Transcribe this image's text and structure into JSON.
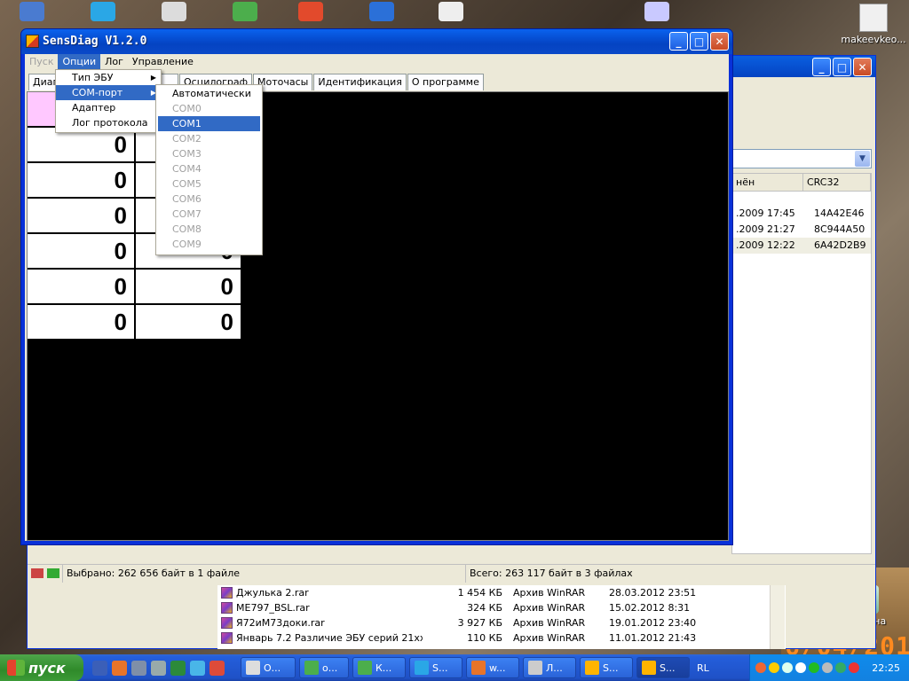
{
  "desktop": {
    "icon_user": "makeevkeo...",
    "icon_recycle": "Корзина",
    "date_stamp": "6/04/201"
  },
  "explorer": {
    "list_headers": [
      "нён",
      "CRC32"
    ],
    "list_rows": [
      {
        "date": ".2009 17:45",
        "crc": "14A42E46"
      },
      {
        "date": ".2009 21:27",
        "crc": "8C944A50"
      },
      {
        "date": ".2009 12:22",
        "crc": "6A42D2B9"
      }
    ],
    "status_left": "Выбрано: 262 656 байт в 1 файле",
    "status_right": "Всего: 263 117 байт в 3 файлах",
    "files": [
      {
        "name": "Джулька 2.rar",
        "size": "1 454 КБ",
        "type": "Архив WinRAR",
        "date": "28.03.2012 23:51"
      },
      {
        "name": "ME797_BSL.rar",
        "size": "324 КБ",
        "type": "Архив WinRAR",
        "date": "15.02.2012 8:31"
      },
      {
        "name": "Я72иМ73доки.rar",
        "size": "3 927 КБ",
        "type": "Архив WinRAR",
        "date": "19.01.2012 23:40"
      },
      {
        "name": "Январь 7.2 Различие ЭБУ серий 21ххх ...",
        "size": "110 КБ",
        "type": "Архив WinRAR",
        "date": "11.01.2012 21:43"
      }
    ]
  },
  "app": {
    "title": "SensDiag V1.2.0",
    "menu": {
      "start": "Пуск",
      "options": "Опции",
      "log": "Лог",
      "control": "Управление"
    },
    "tabs": [
      "Диаг",
      "П",
      "Осцилограф",
      "Моточасы",
      "Идентификация",
      "О программе"
    ],
    "grid": [
      [
        "0",
        "0"
      ],
      [
        "0",
        "0"
      ],
      [
        "0",
        "0"
      ],
      [
        "0",
        "0"
      ],
      [
        "0",
        "0"
      ],
      [
        "0",
        "0"
      ],
      [
        "0",
        "0"
      ]
    ]
  },
  "options_menu": [
    {
      "label": "Тип ЭБУ",
      "has_sub": true
    },
    {
      "label": "COM-порт",
      "has_sub": true
    },
    {
      "label": "Адаптер",
      "has_sub": false
    },
    {
      "label": "Лог протокола",
      "has_sub": false
    }
  ],
  "com_submenu": [
    {
      "label": "Автоматически",
      "state": "enabled"
    },
    {
      "label": "COM0",
      "state": "disabled"
    },
    {
      "label": "COM1",
      "state": "selected"
    },
    {
      "label": "COM2",
      "state": "disabled"
    },
    {
      "label": "COM3",
      "state": "disabled"
    },
    {
      "label": "COM4",
      "state": "disabled"
    },
    {
      "label": "COM5",
      "state": "disabled"
    },
    {
      "label": "COM6",
      "state": "disabled"
    },
    {
      "label": "COM7",
      "state": "disabled"
    },
    {
      "label": "COM8",
      "state": "disabled"
    },
    {
      "label": "COM9",
      "state": "disabled"
    }
  ],
  "taskbar": {
    "start": "пуск",
    "buttons": [
      "О...",
      "о...",
      "К...",
      "S...",
      "w...",
      "Л...",
      "S...",
      "S..."
    ],
    "lang": "RL",
    "clock": "22:25"
  },
  "colors": {
    "menu_highlight": "#316ac5",
    "grid_pink": "#ffc8ff",
    "title_blue": "#0a5fe0"
  }
}
